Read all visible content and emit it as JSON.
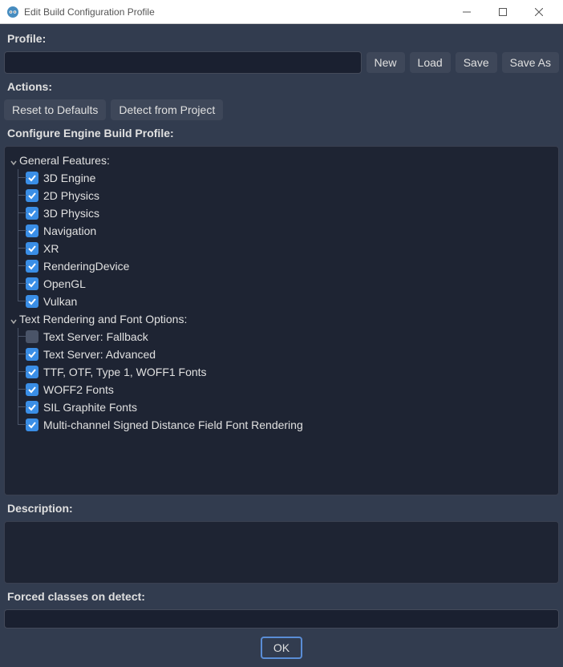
{
  "window": {
    "title": "Edit Build Configuration Profile"
  },
  "profile": {
    "label": "Profile:",
    "value": "",
    "buttons": {
      "new": "New",
      "load": "Load",
      "save": "Save",
      "save_as": "Save As"
    }
  },
  "actions": {
    "label": "Actions:",
    "reset": "Reset to Defaults",
    "detect": "Detect from Project"
  },
  "configure": {
    "label": "Configure Engine Build Profile:"
  },
  "tree": {
    "sections": [
      {
        "label": "General Features:",
        "items": [
          {
            "label": "3D Engine",
            "checked": true
          },
          {
            "label": "2D Physics",
            "checked": true
          },
          {
            "label": "3D Physics",
            "checked": true
          },
          {
            "label": "Navigation",
            "checked": true
          },
          {
            "label": "XR",
            "checked": true
          },
          {
            "label": "RenderingDevice",
            "checked": true
          },
          {
            "label": "OpenGL",
            "checked": true
          },
          {
            "label": "Vulkan",
            "checked": true
          }
        ]
      },
      {
        "label": "Text Rendering and Font Options:",
        "items": [
          {
            "label": "Text Server: Fallback",
            "checked": false
          },
          {
            "label": "Text Server: Advanced",
            "checked": true
          },
          {
            "label": "TTF, OTF, Type 1, WOFF1 Fonts",
            "checked": true
          },
          {
            "label": "WOFF2 Fonts",
            "checked": true
          },
          {
            "label": "SIL Graphite Fonts",
            "checked": true
          },
          {
            "label": "Multi-channel Signed Distance Field Font Rendering",
            "checked": true
          }
        ]
      }
    ]
  },
  "description": {
    "label": "Description:",
    "value": ""
  },
  "forced": {
    "label": "Forced classes on detect:",
    "value": ""
  },
  "ok": "OK"
}
